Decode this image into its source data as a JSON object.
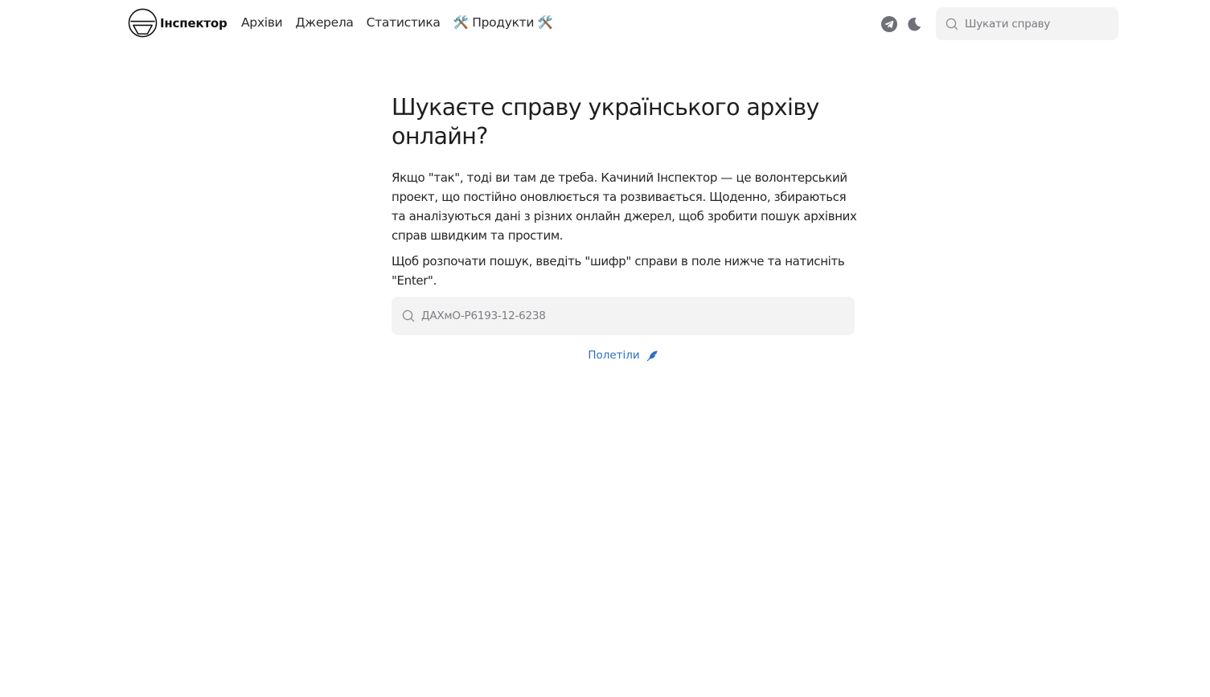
{
  "header": {
    "brand_name": "Інспектор",
    "nav": [
      {
        "label": "Архіви"
      },
      {
        "label": "Джерела"
      },
      {
        "label": "Статистика"
      },
      {
        "label": "🛠️ Продукти 🛠️"
      }
    ],
    "icons": [
      "telegram-icon",
      "moon-icon"
    ],
    "search_placeholder": "Шукати справу"
  },
  "main": {
    "title": "Шукаєте справу українського архіву онлайн?",
    "intro": "Якщо \"так\", тоді ви там де треба. Качиний Інспектор — це волонтерський проект, що постійно оновлюється та розвивається. Щоденно, збираються та аналізуються дані з різних онлайн джерел, щоб зробити пошук архівних справ швидким та простим.",
    "instruction": "Щоб розпочати пошук, введіть \"шифр\" справи в поле нижче та натисніть \"Enter\".",
    "search_placeholder": "ДАХмО-Р6193-12-6238",
    "go_label": "Полетіли"
  },
  "colors": {
    "link": "#2f6fbf",
    "search_bg": "#f3f3f4",
    "icon": "#6f6f78"
  }
}
